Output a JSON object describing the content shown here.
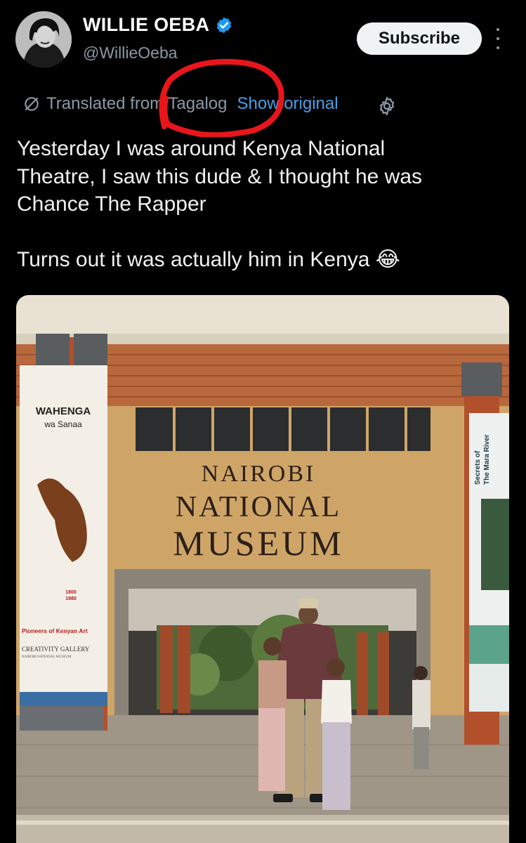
{
  "author": {
    "name": "WILLIE OEBA",
    "handle": "@WillieOeba"
  },
  "subscribe_label": "Subscribe",
  "translation": {
    "prefix": "Translated from Tagalog",
    "action": "Show original"
  },
  "post_text": "Yesterday I was around Kenya National\nTheatre, I saw this dude & I thought he was\nChance The Rapper\n\nTurns out it was actually him in Kenya 😂",
  "photo": {
    "sign_line1": "NAIROBI",
    "sign_line2": "NATIONAL",
    "sign_line3": "MUSEUM",
    "banner_left_title": "WAHENGA",
    "banner_left_sub": "wa Sanaa",
    "banner_left_years1": "1800",
    "banner_left_years2": "1980",
    "banner_left_caption": "Pioneers of Kenyan Art",
    "banner_left_gallery": "CREATIVITY GALLERY",
    "banner_left_museum": "NAIROBI NATIONAL MUSEUM",
    "banner_right_title1": "Secrets of",
    "banner_right_title2": "The Mara River"
  },
  "colors": {
    "accent": "#4a9fe8",
    "verified": "#1d9bf0",
    "annotation": "#e8161b",
    "background": "#000000"
  }
}
